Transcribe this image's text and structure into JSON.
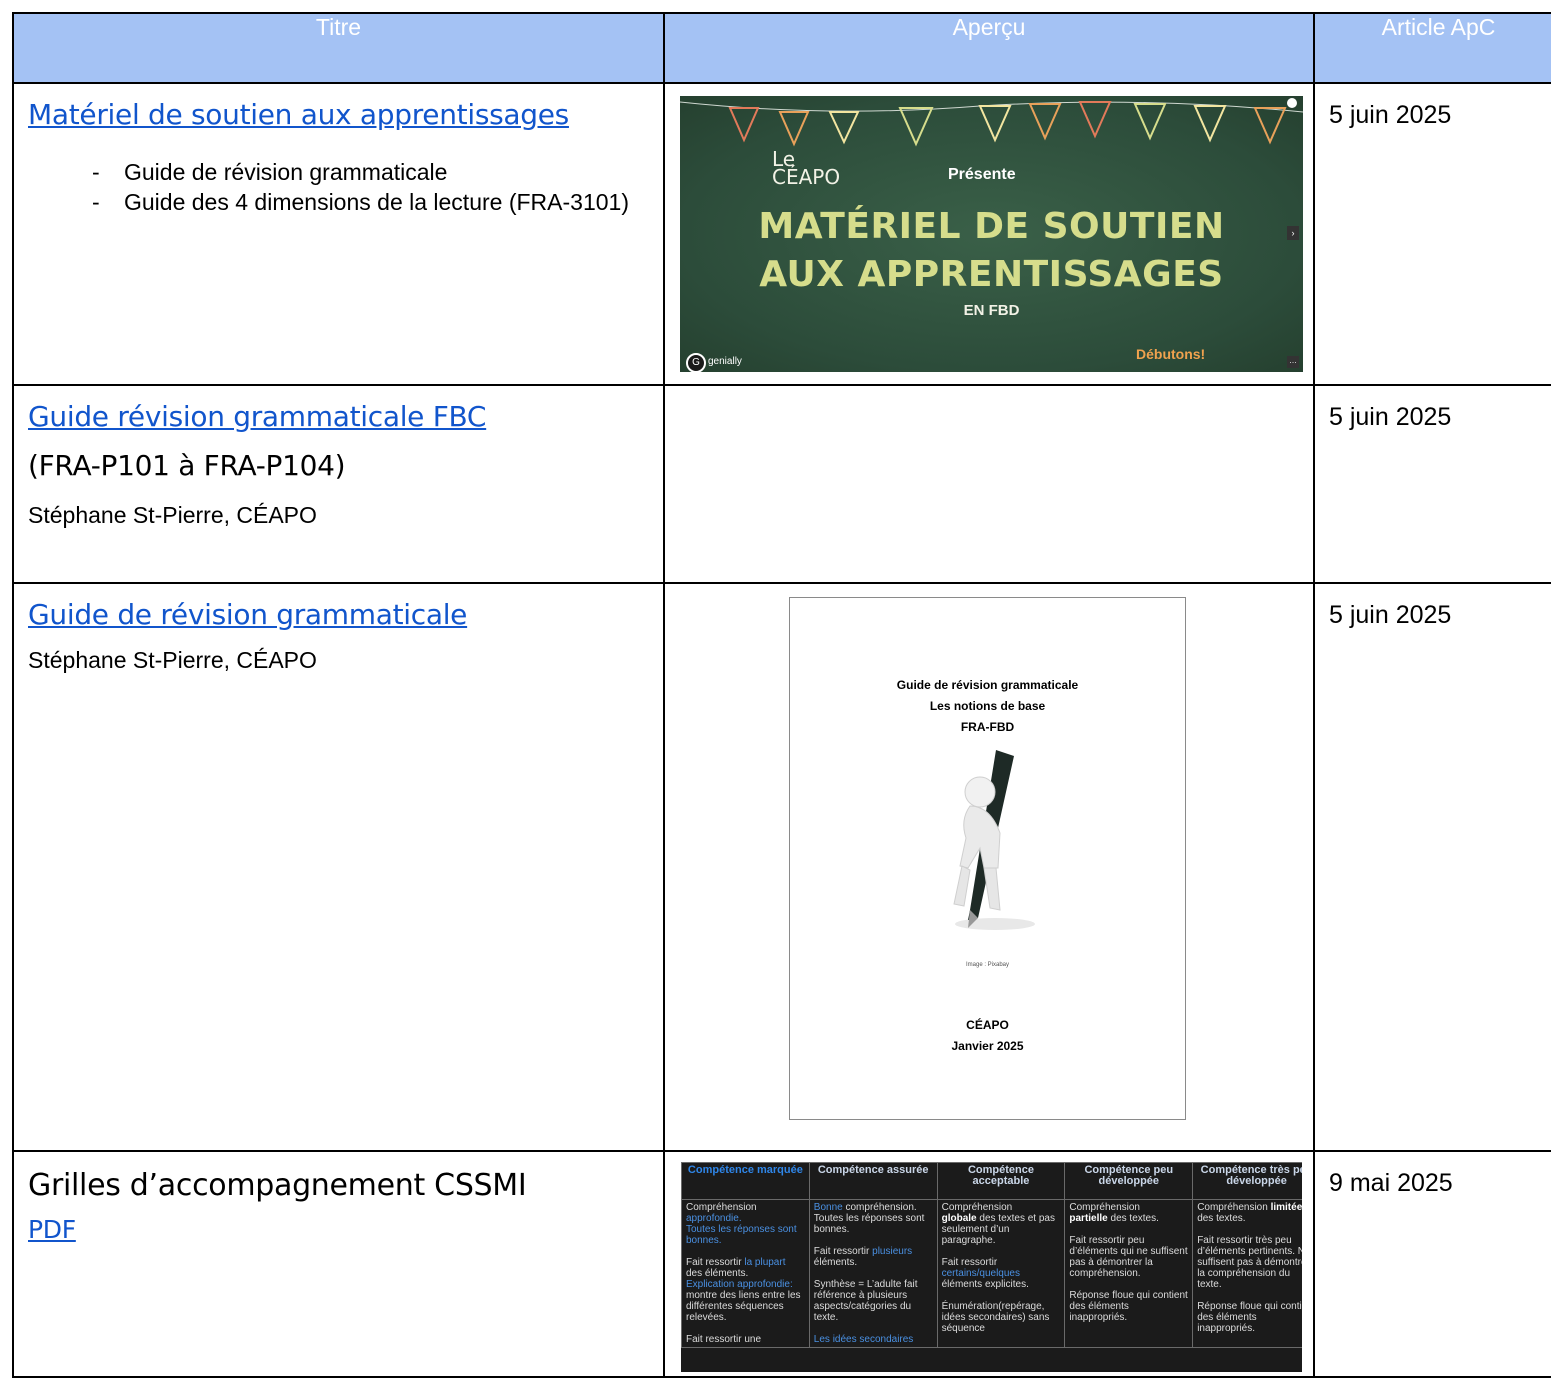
{
  "header": {
    "col1": "Titre",
    "col2": "Aperçu",
    "col3": "Article ApC"
  },
  "rows": [
    {
      "title": "Matériel de soutien aux apprentissages",
      "items": [
        "Guide de révision grammaticale",
        "Guide des 4 dimensions de la lecture (FRA-3101)"
      ],
      "date": "5 juin 2025",
      "preview": {
        "le": "Le",
        "ceapo": "CÉAPO",
        "presente": "Présente",
        "line1": "MATÉRIEL DE SOUTIEN",
        "line2": "AUX APPRENTISSAGES",
        "line3": "EN FBD",
        "cta": "Débutons!",
        "logo": "genially"
      }
    },
    {
      "title": "Guide révision grammaticale FBC",
      "subtitle": "(FRA-P101 à FRA-P104)",
      "author": "Stéphane St-Pierre, CÉAPO",
      "date": "5 juin 2025"
    },
    {
      "title": "Guide de révision grammaticale",
      "author": "Stéphane St-Pierre, CÉAPO",
      "date": "5 juin 2025",
      "preview": {
        "line1": "Guide de révision grammaticale",
        "line2": "Les notions de base",
        "line3": "FRA-FBD",
        "caption": "Image : Pixabay",
        "org": "CÉAPO",
        "date": "Janvier 2025"
      }
    },
    {
      "title": "Grilles d’accompagnement CSSMI",
      "link": "PDF",
      "date": "9 mai 2025",
      "preview": {
        "headers": [
          "Compétence marquée",
          "Compétence assurée",
          "Compétence acceptable",
          "Compétence peu développée",
          "Compétence très peu développée"
        ],
        "col1": [
          "Compréhension",
          "approfondie.",
          "Toutes les réponses sont bonnes.",
          "Fait ressortir",
          "la plupart",
          "des éléments.",
          "Explication approfondie:",
          "montre des liens entre les différentes séquences relevées.",
          "Fait ressortir une"
        ],
        "col2": [
          "Bonne",
          "compréhension. Toutes les réponses sont bonnes.",
          "Fait ressortir",
          "plusieurs",
          "éléments.",
          "Synthèse = L’adulte fait référence à plusieurs aspects/catégories du texte.",
          "Les idées secondaires"
        ],
        "col3": [
          "Compréhension",
          "globale",
          "des textes et pas seulement d’un paragraphe.",
          "Fait ressortir",
          "certains/quelques",
          "éléments explicites.",
          "Énumération(repérage, idées secondaires) sans séquence"
        ],
        "col4": [
          "Compréhension",
          "partielle",
          "des textes.",
          "Fait ressortir peu d’éléments qui ne suffisent pas à démontrer la compréhension.",
          "Réponse floue qui contient des éléments inappropriés."
        ],
        "col5": [
          "Compréhension",
          "limitée",
          "des textes.",
          "Fait ressortir très peu d’éléments pertinents. Ne suffisent pas à démontrer la compréhension du texte.",
          "Réponse floue qui contient des éléments inappropriés."
        ]
      }
    }
  ],
  "colors": {
    "header_bg": "#a4c2f4",
    "link": "#1155cc",
    "chalkboard": "#2f5240",
    "chalk_text": "#d6dd8c",
    "cta": "#f0a24e"
  }
}
